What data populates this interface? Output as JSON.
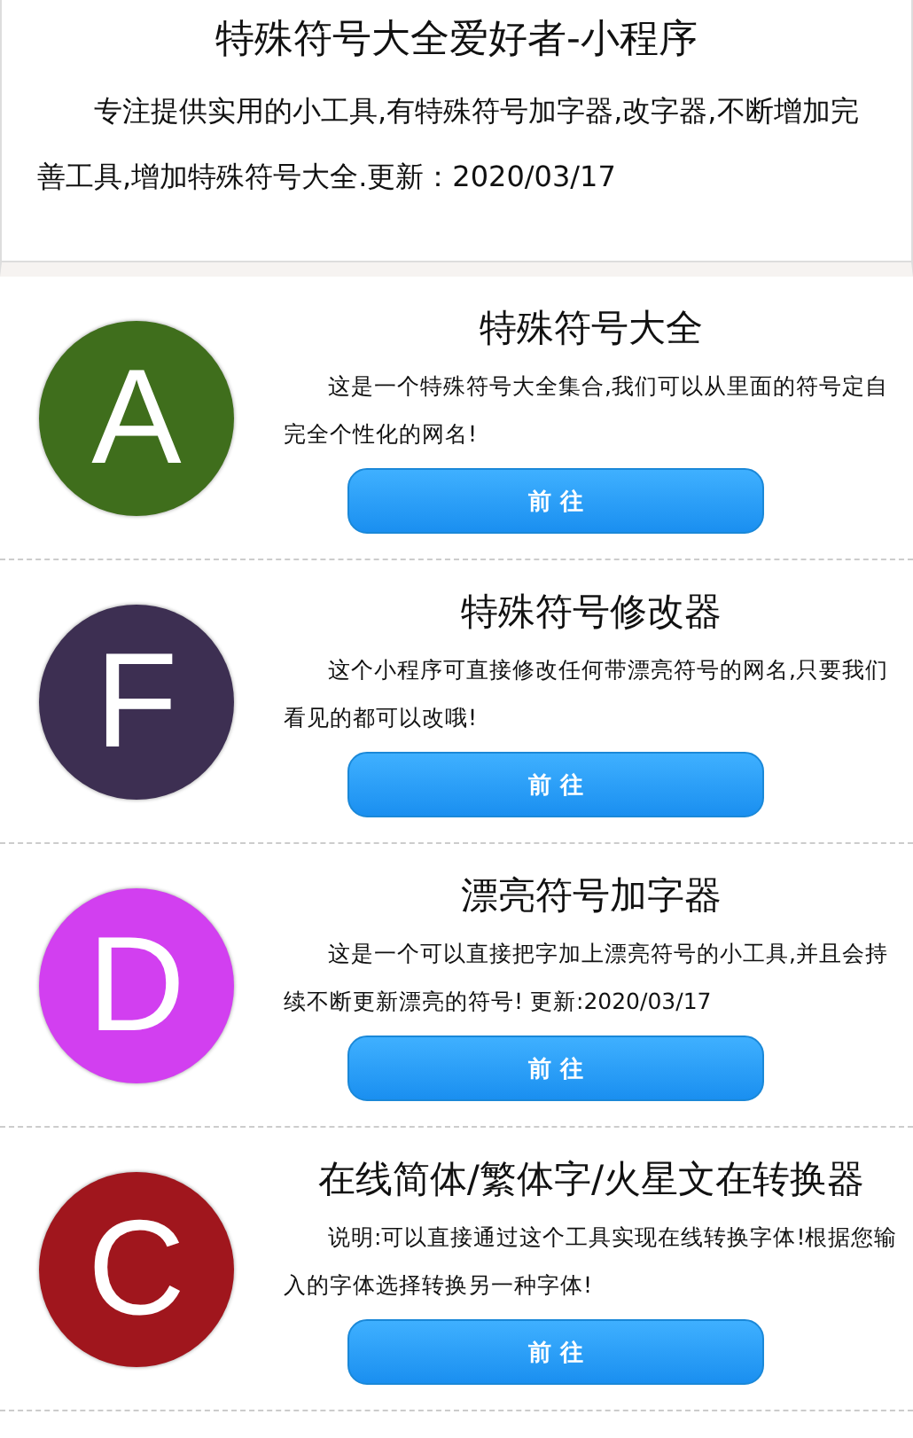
{
  "header": {
    "title": "特殊符号大全爱好者-小程序",
    "description": "专注提供实用的小工具,有特殊符号加字器,改字器,不断增加完善工具,增加特殊符号大全.更新：2020/03/17"
  },
  "tools": [
    {
      "letter": "A",
      "color": "#3f6e1c",
      "title": "特殊符号大全",
      "description": "这是一个特殊符号大全集合,我们可以从里面的符号定自完全个性化的网名!",
      "button": "前 往"
    },
    {
      "letter": "F",
      "color": "#3d2f52",
      "title": "特殊符号修改器",
      "description": "这个小程序可直接修改任何带漂亮符号的网名,只要我们看见的都可以改哦!",
      "button": "前 往"
    },
    {
      "letter": "D",
      "color": "#d23ff0",
      "title": "漂亮符号加字器",
      "description": "这是一个可以直接把字加上漂亮符号的小工具,并且会持续不断更新漂亮的符号! 更新:2020/03/17",
      "button": "前 往"
    },
    {
      "letter": "C",
      "color": "#a0161d",
      "title": "在线简体/繁体字/火星文在转换器",
      "description": "说明:可以直接通过这个工具实现在线转换字体!根据您输入的字体选择转换另一种字体!",
      "button": "前 往"
    }
  ]
}
